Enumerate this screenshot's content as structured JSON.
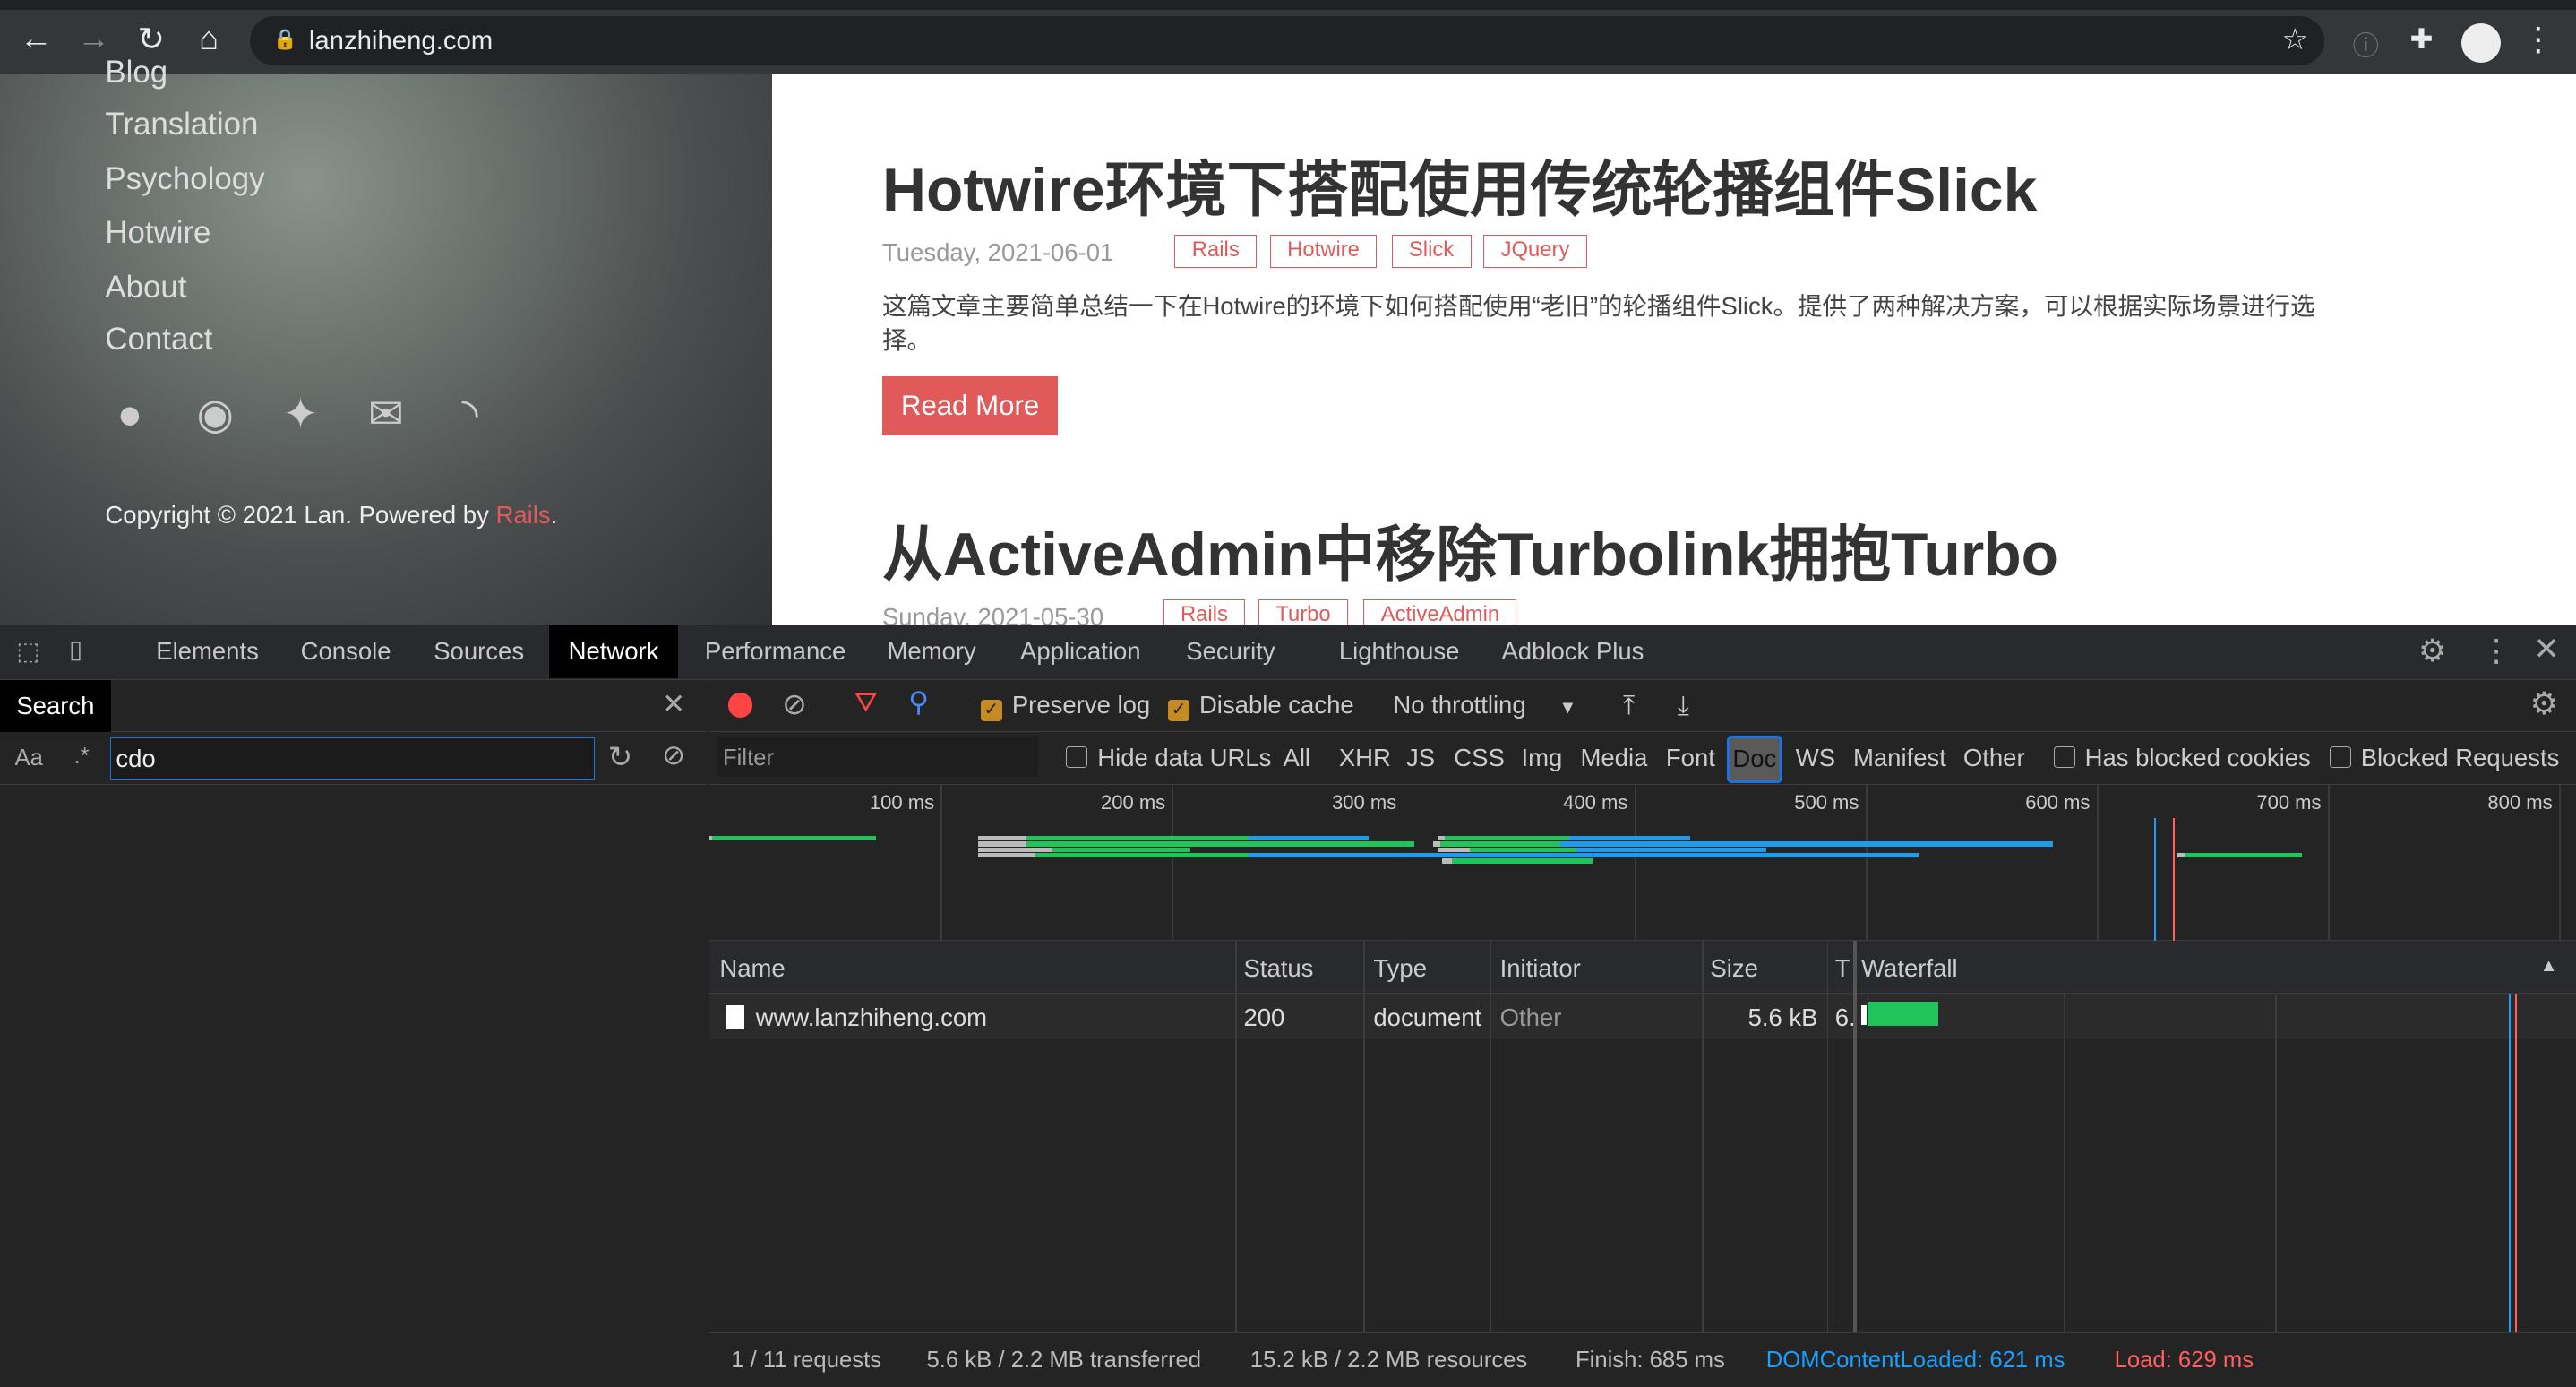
{
  "browser": {
    "url": "lanzhiheng.com"
  },
  "sidebar": {
    "nav": [
      "Blog",
      "Translation",
      "Psychology",
      "Hotwire",
      "About",
      "Contact"
    ],
    "social_icons": [
      "github-icon",
      "weibo-icon",
      "twitter-icon",
      "mail-icon",
      "rss-icon"
    ],
    "copyright": "Copyright © 2021 Lan. Powered by ",
    "powered_link": "Rails",
    "period": "."
  },
  "posts": [
    {
      "title": "Hotwire环境下搭配使用传统轮播组件Slick",
      "date": "Tuesday, 2021-06-01",
      "tags": [
        "Rails",
        "Hotwire",
        "Slick",
        "JQuery"
      ],
      "excerpt": "这篇文章主要简单总结一下在Hotwire的环境下如何搭配使用“老旧”的轮播组件Slick。提供了两种解决方案，可以根据实际场景进行选择。",
      "read_more": "Read More"
    },
    {
      "title": "从ActiveAdmin中移除Turbolink拥抱Turbo",
      "date": "Sunday, 2021-05-30",
      "tags": [
        "Rails",
        "Turbo",
        "ActiveAdmin"
      ]
    }
  ],
  "devtools": {
    "tabs": [
      "Elements",
      "Console",
      "Sources",
      "Network",
      "Performance",
      "Memory",
      "Application",
      "Security",
      "Lighthouse",
      "Adblock Plus"
    ],
    "active_tab": "Network",
    "search": {
      "title": "Search",
      "case_label": "Aa",
      "regex_label": ".*",
      "value": "cdo"
    },
    "toolbar": {
      "preserve_log": "Preserve log",
      "disable_cache": "Disable cache",
      "throttling": "No throttling"
    },
    "filter": {
      "placeholder": "Filter",
      "hide_data_urls": "Hide data URLs",
      "types": [
        "All",
        "XHR",
        "JS",
        "CSS",
        "Img",
        "Media",
        "Font",
        "Doc",
        "WS",
        "Manifest",
        "Other"
      ],
      "active_type": "Doc",
      "has_blocked_cookies": "Has blocked cookies",
      "blocked_requests": "Blocked Requests"
    },
    "overview": {
      "ticks": [
        "100 ms",
        "200 ms",
        "300 ms",
        "400 ms",
        "500 ms",
        "600 ms",
        "700 ms",
        "800 ms"
      ],
      "dom_content_loaded_ms": 625,
      "load_ms": 633,
      "bars": [
        {
          "lane": 0,
          "segs": [
            [
              0,
              1,
              "w"
            ],
            [
              1,
              72,
              "g"
            ]
          ]
        },
        {
          "lane": 0,
          "segs": [
            [
              116,
              137,
              "w"
            ],
            [
              137,
              233,
              "g"
            ],
            [
              233,
              285,
              "b"
            ]
          ]
        },
        {
          "lane": 0,
          "segs": [
            [
              315,
              318,
              "w"
            ],
            [
              318,
              372,
              "g"
            ],
            [
              372,
              424,
              "b"
            ]
          ]
        },
        {
          "lane": 1,
          "segs": [
            [
              116,
              137,
              "w"
            ],
            [
              137,
              305,
              "g"
            ]
          ]
        },
        {
          "lane": 1,
          "segs": [
            [
              313,
              316,
              "w"
            ],
            [
              316,
              368,
              "g"
            ],
            [
              368,
              581,
              "b"
            ]
          ]
        },
        {
          "lane": 2,
          "segs": [
            [
              116,
              148,
              "w"
            ],
            [
              148,
              208,
              "g"
            ]
          ]
        },
        {
          "lane": 2,
          "segs": [
            [
              315,
              329,
              "w"
            ],
            [
              329,
              375,
              "g"
            ],
            [
              375,
              457,
              "b"
            ]
          ]
        },
        {
          "lane": 3,
          "segs": [
            [
              116,
              141,
              "w"
            ],
            [
              141,
              233,
              "g"
            ],
            [
              233,
              523,
              "b"
            ]
          ]
        },
        {
          "lane": 3,
          "segs": [
            [
              635,
              638,
              "w"
            ],
            [
              638,
              689,
              "g"
            ]
          ]
        },
        {
          "lane": 4,
          "segs": [
            [
              317,
              321,
              "w"
            ],
            [
              321,
              382,
              "g"
            ]
          ]
        }
      ]
    },
    "table": {
      "headers": [
        "Name",
        "Status",
        "Type",
        "Initiator",
        "Size",
        "T",
        "Waterfall"
      ],
      "rows": [
        {
          "name": "www.lanzhiheng.com",
          "status": "200",
          "type": "document",
          "initiator": "Other",
          "size": "5.6 kB",
          "time": "6."
        }
      ]
    },
    "status": {
      "requests": "1 / 11 requests",
      "transferred": "5.6 kB / 2.2 MB transferred",
      "resources": "15.2 kB / 2.2 MB resources",
      "finish": "Finish: 685 ms",
      "dcl": "DOMContentLoaded: 621 ms",
      "load": "Load: 629 ms"
    },
    "colors": {
      "dcl": "#1a9fff",
      "load": "#ff5f5f",
      "green": "#20c45a",
      "blue": "#1e9be9"
    }
  }
}
